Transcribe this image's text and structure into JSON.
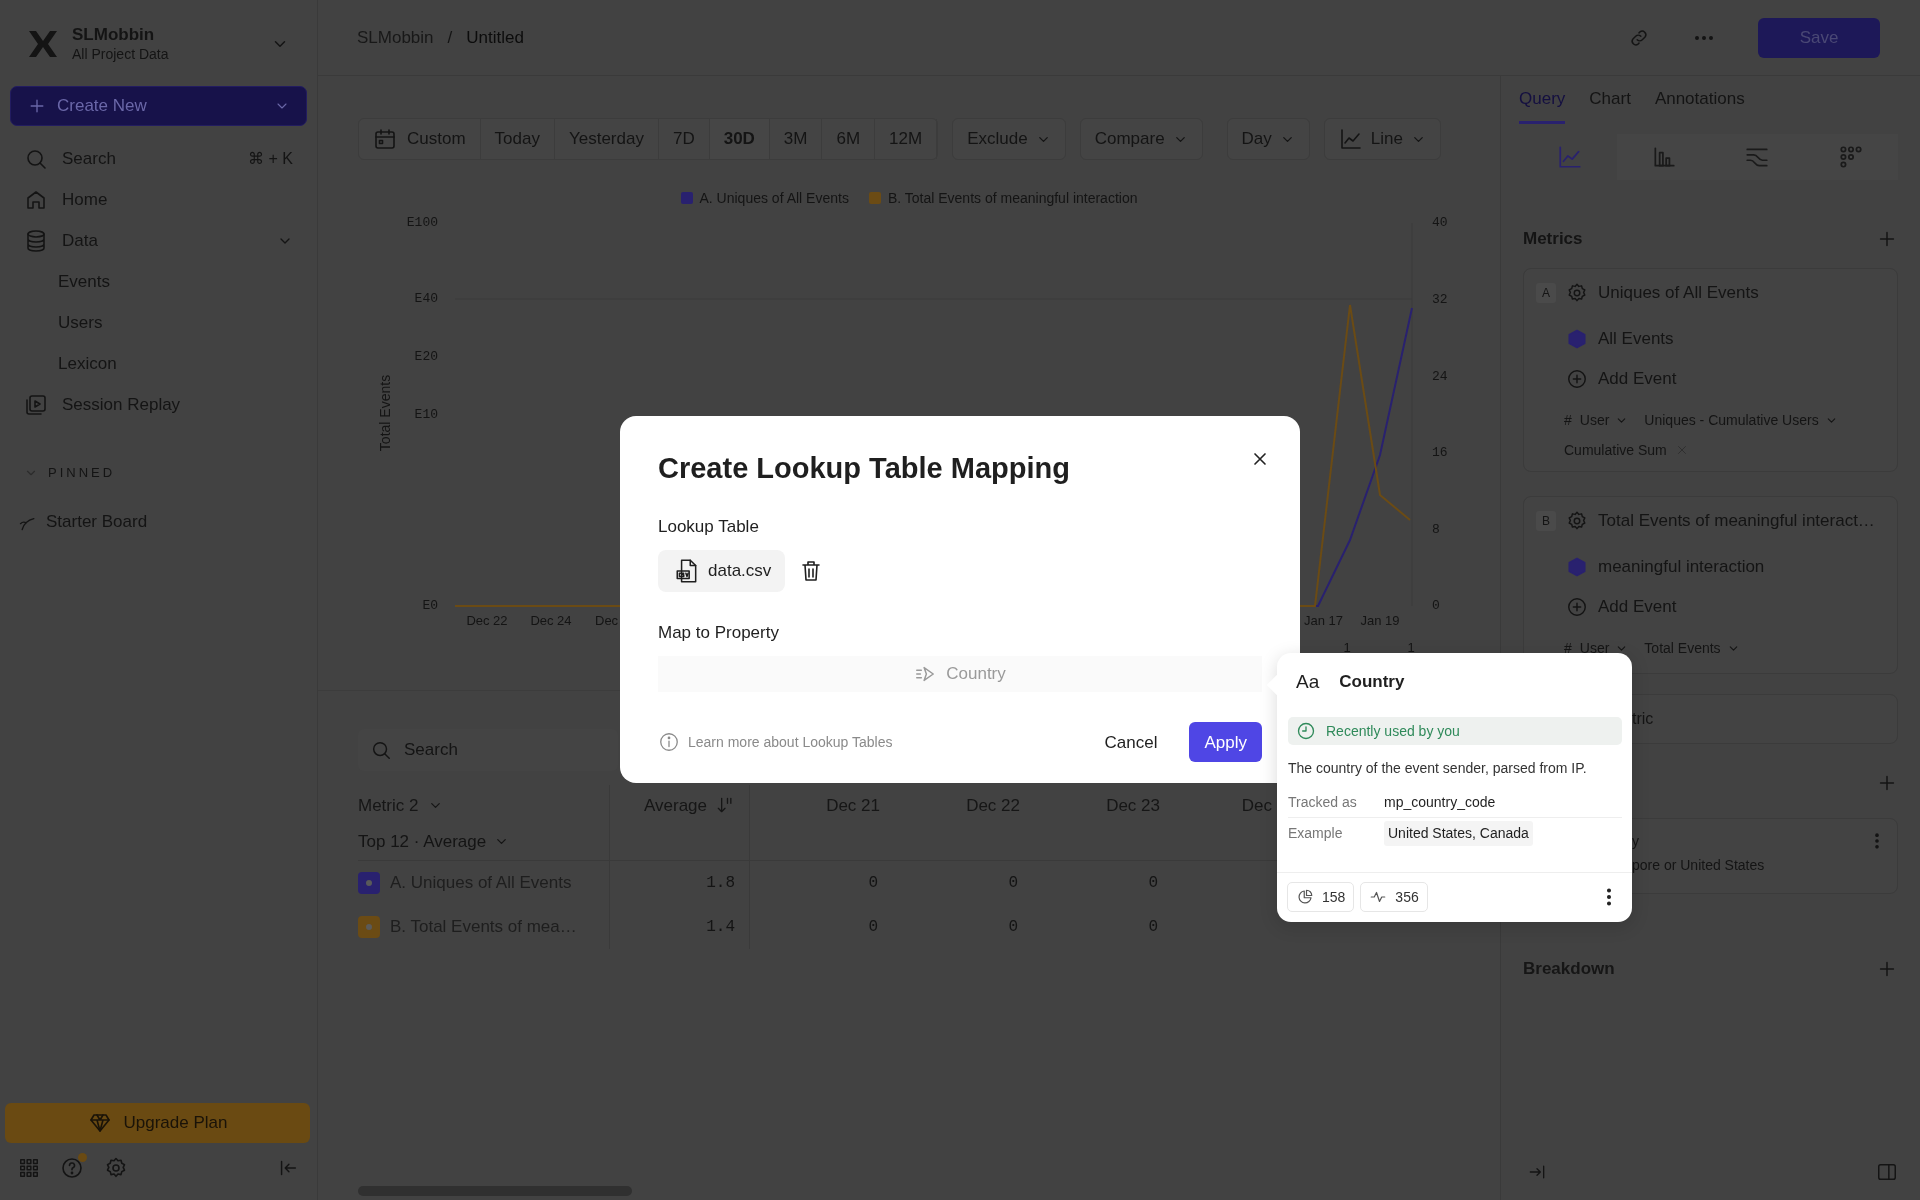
{
  "sidebar": {
    "workspace": {
      "name": "SLMobbin",
      "subtitle": "All Project Data"
    },
    "create_button": {
      "label": "Create New"
    },
    "nav": [
      {
        "kind": "search",
        "label": "Search",
        "shortcut": "⌘ + K"
      },
      {
        "kind": "home",
        "label": "Home"
      },
      {
        "kind": "data",
        "label": "Data",
        "expanded": true,
        "children": [
          {
            "label": "Events"
          },
          {
            "label": "Users"
          },
          {
            "label": "Lexicon"
          }
        ]
      },
      {
        "kind": "replay",
        "label": "Session Replay"
      }
    ],
    "pinned": {
      "label": "PINNED",
      "expanded": true,
      "items": [
        {
          "label": "Starter Board"
        }
      ]
    },
    "upgrade_button": {
      "label": "Upgrade Plan"
    }
  },
  "header": {
    "breadcrumb": [
      {
        "label": "SLMobbin"
      },
      {
        "label": "Untitled"
      }
    ],
    "separator": "/",
    "save_button": {
      "label": "Save"
    }
  },
  "toolbar": {
    "ranges": [
      {
        "label": "Custom",
        "selected": false
      },
      {
        "label": "Today",
        "selected": false
      },
      {
        "label": "Yesterday",
        "selected": false
      },
      {
        "label": "7D",
        "selected": false
      },
      {
        "label": "30D",
        "selected": true
      },
      {
        "label": "3M",
        "selected": false
      },
      {
        "label": "6M",
        "selected": false
      },
      {
        "label": "12M",
        "selected": false
      }
    ],
    "filters": [
      {
        "label": "Exclude"
      },
      {
        "label": "Compare"
      }
    ],
    "interval": {
      "label": "Day"
    },
    "chart_type": {
      "label": "Line"
    }
  },
  "chart": {
    "legend": [
      {
        "label": "A. Uniques of All Events",
        "color": "#29216f"
      },
      {
        "label": "B. Total Events of meaningful interaction",
        "color": "#6b4b14"
      }
    ],
    "y_title": "Total Events",
    "left_ticks": [
      "E100",
      "E40",
      "E20",
      "E10",
      "E0"
    ],
    "right_ticks": [
      "40",
      "32",
      "24",
      "16",
      "8",
      "0"
    ],
    "x_labels": [
      "Dec 22",
      "Dec 24",
      "Dec",
      "Jan 17",
      "Jan 19"
    ],
    "secondary_labels": [
      "1",
      "1"
    ]
  },
  "table": {
    "search": {
      "placeholder": "Search"
    },
    "metric_header": "Metric 2",
    "metric_sub": "Top 12 · Average",
    "columns": [
      "Average",
      "Dec 21",
      "Dec 22",
      "Dec 23",
      "Dec"
    ],
    "rows": [
      {
        "label": "A. Uniques of All Events",
        "color": "#29216f",
        "cells": [
          "1.8",
          "0",
          "0",
          "0"
        ]
      },
      {
        "label": "B. Total Events of mea…",
        "color": "#6b4b14",
        "cells": [
          "1.4",
          "0",
          "0",
          "0"
        ]
      }
    ]
  },
  "right_panel": {
    "tabs": [
      {
        "label": "Query",
        "selected": true
      },
      {
        "label": "Chart",
        "selected": false
      },
      {
        "label": "Annotations",
        "selected": false
      }
    ],
    "views": [
      {
        "kind": "line",
        "selected": true
      },
      {
        "kind": "bar",
        "selected": false
      },
      {
        "kind": "flow",
        "selected": false
      },
      {
        "kind": "grid",
        "selected": false
      }
    ],
    "metrics_title": "Metrics",
    "metrics": [
      {
        "letter": "A",
        "title": "Uniques of All Events",
        "event": "All Events",
        "add_event": "Add Event",
        "type_glyph": "#",
        "measure": [
          "User",
          "Uniques - Cumulative Users"
        ],
        "modifier": "Cumulative Sum"
      },
      {
        "letter": "B",
        "title": "Total Events of meaningful interact…",
        "event": "meaningful interaction",
        "add_event": "Add Event",
        "type_glyph": "#",
        "measure": [
          "User",
          "Total Events"
        ]
      }
    ],
    "add_metric": "tric",
    "filter_card": {
      "name": "y",
      "text": "pore or United States"
    },
    "breakdown_title": "Breakdown"
  },
  "modal": {
    "title": "Create Lookup Table Mapping",
    "lookup_label": "Lookup Table",
    "file": {
      "name": "data.csv"
    },
    "map_label": "Map to Property",
    "property": {
      "value": "Country"
    },
    "learn_more": "Learn more about Lookup Tables",
    "cancel": "Cancel",
    "apply": "Apply"
  },
  "popover": {
    "type_glyph": "Aa",
    "name": "Country",
    "recent": "Recently used by you",
    "description": "The country of the event sender, parsed from IP.",
    "details": [
      {
        "label": "Tracked as",
        "value": "mp_country_code",
        "kind": "code"
      },
      {
        "label": "Example",
        "value": "United States, Canada",
        "kind": "chip"
      }
    ],
    "stats": [
      {
        "kind": "pie",
        "value": "158"
      },
      {
        "kind": "activity",
        "value": "356"
      }
    ]
  }
}
